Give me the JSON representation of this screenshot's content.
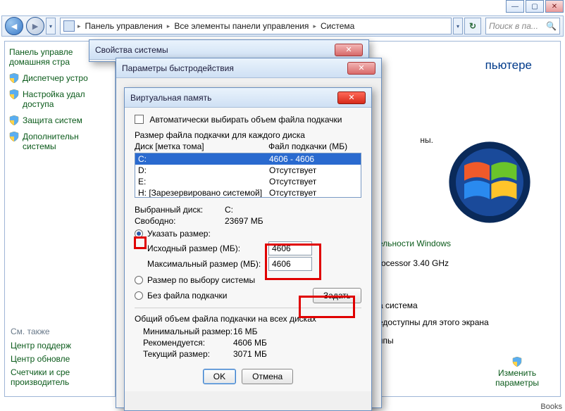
{
  "window_controls": {
    "min": "—",
    "max": "▢",
    "close": "✕"
  },
  "addressbar": {
    "crumbs": [
      "Панель управления",
      "Все элементы панели управления",
      "Система"
    ],
    "search_placeholder": "Поиск в па...",
    "refresh_glyph": "↻"
  },
  "sidebar": {
    "header1": "Панель управле",
    "header2": "домашняя стра",
    "items": [
      "Диспетчер устро",
      "Настройка удал\nдоступа",
      "Защита систем",
      "Дополнительн\nсистемы"
    ],
    "see_also_label": "См. также",
    "see_also": [
      "Центр поддерж",
      "Центр обновле",
      "Счетчики и сре\nпроизводитель"
    ]
  },
  "system_page": {
    "heading_suffix": "пьютере",
    "info_lines": [
      "ны.",
      ""
    ],
    "perf_heading": "ельности Windows",
    "cpu_line": "rocessor   3.40 GHz",
    "os_heading": "а система",
    "os_line": "едоступны для этого экрана",
    "ram_label": "ппы",
    "change_link": "Изменить\nпараметры"
  },
  "dlg_props": {
    "title": "Свойства системы"
  },
  "dlg_perf": {
    "title": "Параметры быстродействия"
  },
  "dlg_vm": {
    "title": "Виртуальная память",
    "auto_checkbox": "Автоматически выбирать объем файла подкачки",
    "each_drive": "Размер файла подкачки для каждого диска",
    "col_drive": "Диск [метка тома]",
    "col_pf": "Файл подкачки (МБ)",
    "drives": [
      {
        "label": "C:",
        "pf": "4606 - 4606",
        "selected": true
      },
      {
        "label": "D:",
        "pf": "Отсутствует"
      },
      {
        "label": "E:",
        "pf": "Отсутствует"
      },
      {
        "label": "H:     [Зарезервировано системой]",
        "pf": "Отсутствует"
      }
    ],
    "selected_drive_k": "Выбранный диск:",
    "selected_drive_v": "C:",
    "free_k": "Свободно:",
    "free_v": "23697 МБ",
    "radio_custom": "Указать размер:",
    "initial_k": "Исходный размер (МБ):",
    "initial_v": "4606",
    "max_k": "Максимальный размер (МБ):",
    "max_v": "4606",
    "radio_system": "Размер по выбору системы",
    "radio_none": "Без файла подкачки",
    "set_btn": "Задать",
    "total_heading": "Общий объем файла подкачки на всех дисках",
    "min_k": "Минимальный размер:",
    "min_v": "16 МБ",
    "rec_k": "Рекомендуется:",
    "rec_v": "4606 МБ",
    "cur_k": "Текущий размер:",
    "cur_v": "3071 МБ",
    "ok": "OK",
    "cancel": "Отмена"
  },
  "footer": {
    "text": "Books"
  }
}
